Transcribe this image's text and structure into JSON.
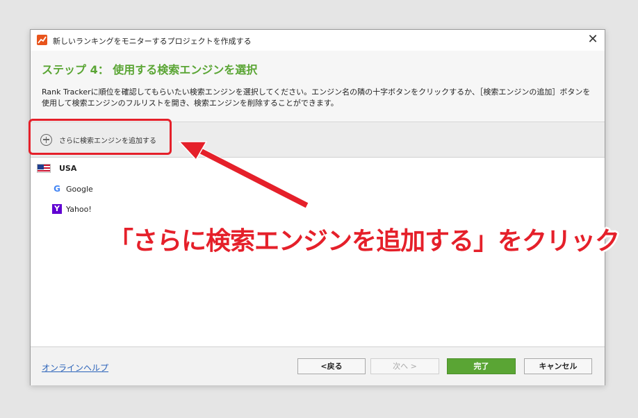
{
  "window": {
    "title": "新しいランキングをモニターするプロジェクトを作成する",
    "close_glyph": "✕"
  },
  "header": {
    "step_title": "ステップ 4： 使用する検索エンジンを選択",
    "description": "Rank Trackerに順位を確認してもらいたい検索エンジンを選択してください。エンジン名の隣の十字ボタンをクリックするか、［検索エンジンの追加］ボタンを使用して検索エンジンのフルリストを開き、検索エンジンを削除することができます。"
  },
  "toolbar": {
    "add_label": "さらに検索エンジンを追加する"
  },
  "engines": {
    "country": "USA",
    "items": [
      {
        "name": "Google",
        "icon": "google-icon",
        "glyph": "G"
      },
      {
        "name": "Yahoo!",
        "icon": "yahoo-icon",
        "glyph": "Y"
      }
    ]
  },
  "footer": {
    "help_label": "オンラインヘルプ",
    "back_label": "<戻る",
    "next_label": "次へ >",
    "finish_label": "完了",
    "cancel_label": "キャンセル"
  },
  "annotation": {
    "text": "「さらに検索エンジンを追加する」をクリック",
    "color": "#e5202a"
  },
  "colors": {
    "accent_green": "#5aa534",
    "link_blue": "#2a62b9",
    "annotation_red": "#e5202a"
  }
}
